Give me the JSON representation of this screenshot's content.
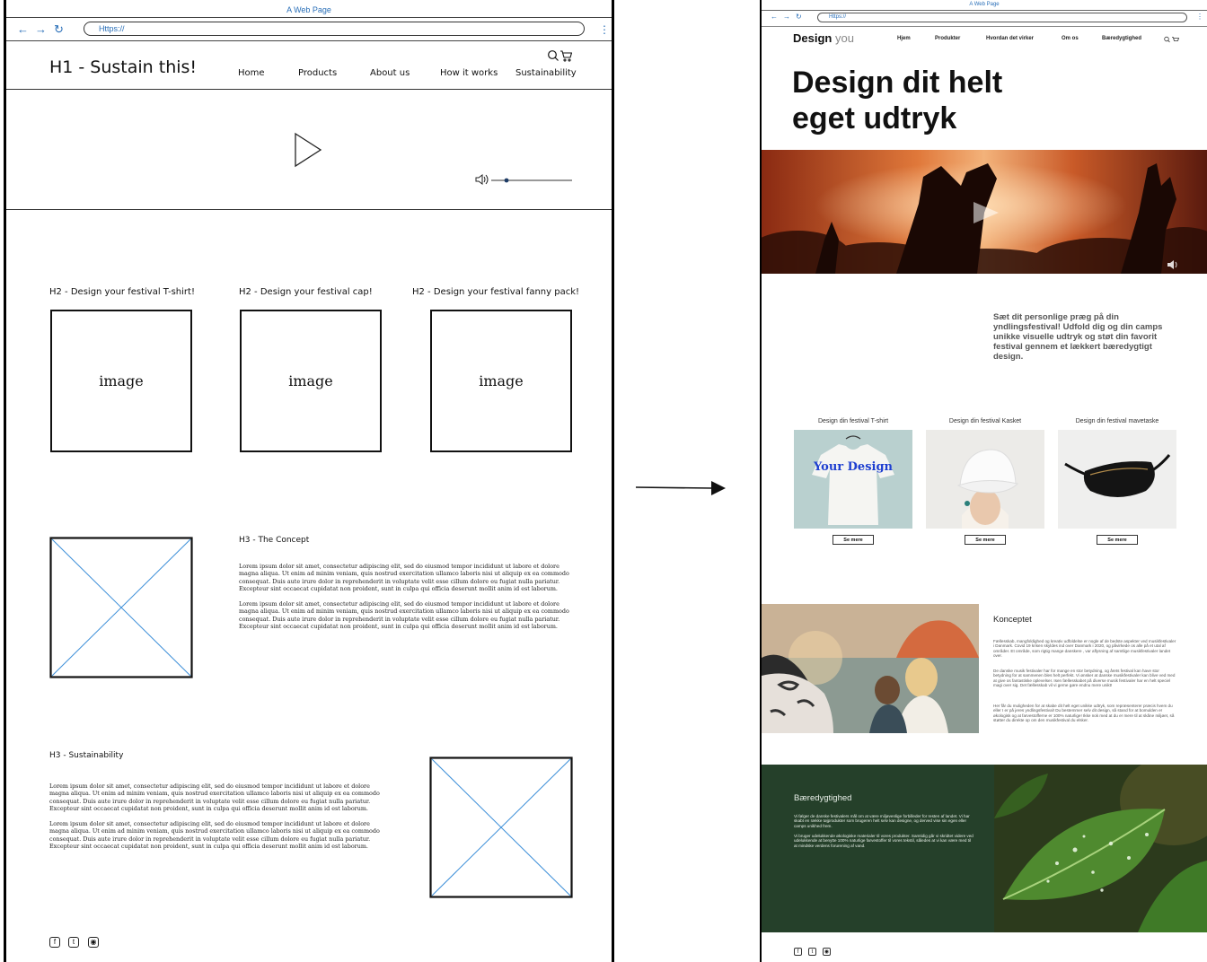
{
  "wireframe": {
    "browser_title": "A Web Page",
    "url": "Https://",
    "h1": "H1 - Sustain this!",
    "menu": [
      "Home",
      "Products",
      "About us",
      "How it works",
      "Sustainability"
    ],
    "products": [
      {
        "heading": "H2 - Design your festival T-shirt!",
        "image_label": "image"
      },
      {
        "heading": "H2 - Design your festival cap!",
        "image_label": "image"
      },
      {
        "heading": "H2 - Design your festival fanny pack!",
        "image_label": "image"
      }
    ],
    "concept_heading": "H3 - The Concept",
    "sustainability_heading": "H3 - Sustainability",
    "lorem": "Lorem ipsum dolor sit amet, consectetur adipiscing elit, sed do eiusmod tempor incididunt ut labore et dolore magna aliqua. Ut enim ad minim veniam, quis nostrud exercitation ullamco laboris nisi ut aliquip ex ea commodo consequat. Duis aute irure dolor in reprehenderit in voluptate velit esse cillum dolore eu fugiat nulla pariatur. Excepteur sint occaecat cupidatat non proident, sunt in culpa qui officia deserunt mollit anim id est laborum.",
    "colors": {
      "accent": "#2a6fb8",
      "ink": "#111111"
    }
  },
  "mockup": {
    "browser_title": "A Web Page",
    "url": "Https://",
    "logo_main": "Design",
    "logo_sub": "you",
    "menu": [
      "Hjem",
      "Produkter",
      "Hvordan det virker",
      "Om os",
      "Bæredygtighed"
    ],
    "hero_title_line1": "Design dit helt",
    "hero_title_line2": "eget udtryk",
    "intro": "Sæt dit personlige præg på din yndlingsfestival! Udfold dig og din camps unikke visuelle udtryk og støt din favorit festival gennem et lækkert bæredygtigt design.",
    "products": [
      {
        "title": "Design din festival T-shirt",
        "button": "Se mere",
        "print": "Your Design"
      },
      {
        "title": "Design din festival Kasket",
        "button": "Se mere"
      },
      {
        "title": "Design din festival mavetaske",
        "button": "Se mere"
      }
    ],
    "konceptet": {
      "heading": "Konceptet",
      "p1": "Fællesskab, mangfoldighed og kreativ udfoldelse er nogle af de bedste aspekter ved musikfestivaler i Danmark. Covid 19 krisen skyldes ind over Danmark i 2020, og påvirkede os alle på et utal af områder. Et område, som rigtig mange danskere , var aflysning af samtlige musikfestivaler landet over.",
      "p2": "De danske musik festivaler har for mange en stor betydning, og årets festival kan have stor betydning for at sammenen bles helt perfekt. Vi ønsker at danske musikfestivaler kan blive ved med at give os fantastiske oplevelser. Isen fællesskabet på diverse musik festivaler har en helt speciel magi over sig. Det fællesskab vil vi gerne gøre endnu mere unikt!",
      "p3": "Her får du muligheden for at skabe dit helt eget unikke udtryk, som repræsenterer præcis hvem du eller I er på jeres yndlingsfestival! Du bestemmer selv dit design, så stand for at bomulden er økologisk og at farvestofferne er 100% naturlige! Ikke nok med at du er mere til at skåne miljøet, så støtter du direkte op om den musikfestival du elsker."
    },
    "sustainability": {
      "heading": "Bæredygtighed",
      "p1": "Vi følger de danske festivalers mål om at være miljøvenlige forbilleder for resten af landet. Vi har skabt en række tøjprodukter som brugeren helt selv kan designe, og derved vise sin egen eller camps unikhed frem.",
      "p2": "Vi bruger udelukkende økologiske materialer til vores produkter. Samtidig går vi skridtet videre ved udelukkende at benytte 100% naturlige farvestoffer til vores tekstil, således at vi kan være med til at mindske verdens forurening af vand."
    },
    "colors": {
      "green": "#25402a",
      "accent": "#2a6fb8"
    }
  }
}
